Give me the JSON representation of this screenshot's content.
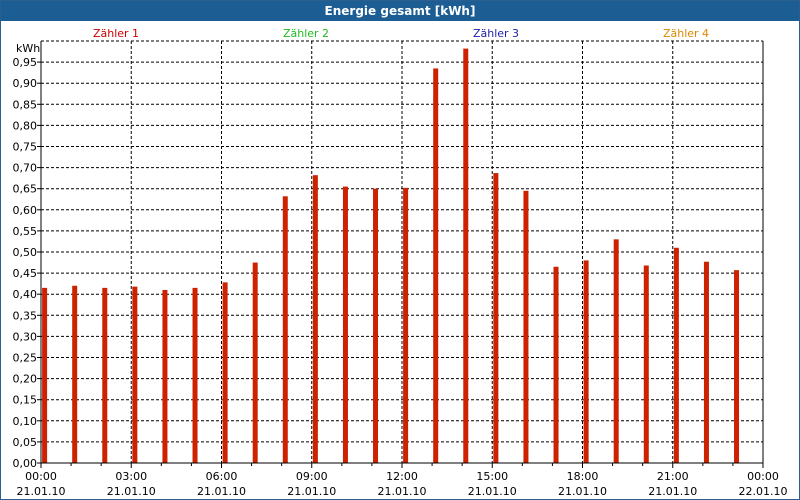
{
  "window": {
    "title": "Energie gesamt [kWh]"
  },
  "chart_data": {
    "type": "bar",
    "title": "Energie gesamt [kWh]",
    "ylabel": "kWh",
    "xlabel": "",
    "ylim": [
      0,
      1.0
    ],
    "grid": true,
    "yticks": [
      "0,00",
      "0,05",
      "0,10",
      "0,15",
      "0,20",
      "0,25",
      "0,30",
      "0,35",
      "0,40",
      "0,45",
      "0,50",
      "0,55",
      "0,60",
      "0,65",
      "0,70",
      "0,75",
      "0,80",
      "0,85",
      "0,90",
      "0,95"
    ],
    "xticks": [
      {
        "time": "00:00",
        "date": "21.01.10"
      },
      {
        "time": "03:00",
        "date": "21.01.10"
      },
      {
        "time": "06:00",
        "date": "21.01.10"
      },
      {
        "time": "09:00",
        "date": "21.01.10"
      },
      {
        "time": "12:00",
        "date": "21.01.10"
      },
      {
        "time": "15:00",
        "date": "21.01.10"
      },
      {
        "time": "18:00",
        "date": "21.01.10"
      },
      {
        "time": "21:00",
        "date": "21.01.10"
      },
      {
        "time": "00:00",
        "date": "22.01.10"
      }
    ],
    "legend": [
      {
        "name": "Zähler 1",
        "color": "#cc0000"
      },
      {
        "name": "Zähler 2",
        "color": "#22bb22"
      },
      {
        "name": "Zähler 3",
        "color": "#2222aa"
      },
      {
        "name": "Zähler 4",
        "color": "#dd8800"
      }
    ],
    "legend_position": "top",
    "series": [
      {
        "name": "Zähler 1",
        "color": "#cc2200",
        "x": [
          "00:00",
          "01:00",
          "02:00",
          "03:00",
          "04:00",
          "05:00",
          "06:00",
          "07:00",
          "08:00",
          "09:00",
          "10:00",
          "11:00",
          "12:00",
          "13:00",
          "14:00",
          "15:00",
          "16:00",
          "17:00",
          "18:00",
          "19:00",
          "20:00",
          "21:00",
          "22:00",
          "23:00"
        ],
        "values": [
          0.415,
          0.42,
          0.415,
          0.418,
          0.41,
          0.415,
          0.428,
          0.475,
          0.632,
          0.682,
          0.655,
          0.65,
          0.652,
          0.935,
          0.982,
          0.687,
          0.645,
          0.465,
          0.48,
          0.53,
          0.468,
          0.51,
          0.477,
          0.457
        ]
      }
    ]
  }
}
